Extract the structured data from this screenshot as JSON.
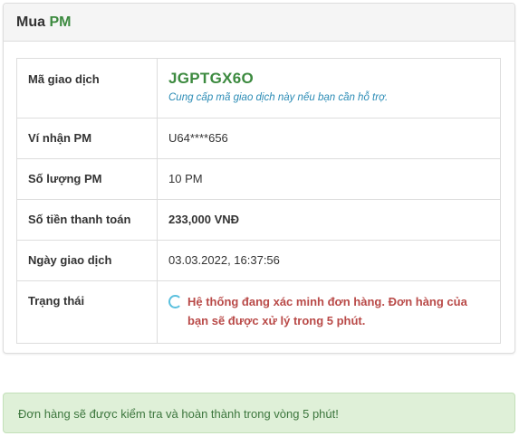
{
  "panel": {
    "title_prefix": "Mua",
    "title_accent": "PM"
  },
  "details": {
    "transaction_id_label": "Mã giao dịch",
    "transaction_id": "JGPTGX6O",
    "transaction_hint": "Cung cấp mã giao dịch này nếu bạn cần hỗ trợ.",
    "wallet_label": "Ví nhận PM",
    "wallet": "U64****656",
    "quantity_label": "Số lượng PM",
    "quantity": "10 PM",
    "amount_label": "Số tiền thanh toán",
    "amount": "233,000 VNĐ",
    "date_label": "Ngày giao dịch",
    "date": "03.03.2022, 16:37:56",
    "status_label": "Trạng thái",
    "status_text": "Hệ thống đang xác minh đơn hàng. Đơn hàng của bạn sẽ được xử lý trong 5 phút.",
    "status_icon": "spinner-icon"
  },
  "alert": {
    "message": "Đơn hàng sẽ được kiểm tra và hoàn thành trong vòng 5 phút!"
  },
  "colors": {
    "accent_green": "#3c8a3f",
    "hint_blue": "#2a8bb5",
    "status_red": "#b94a48",
    "spinner": "#5bc0de",
    "alert_bg": "#dff0d8",
    "alert_text": "#3c763d"
  }
}
